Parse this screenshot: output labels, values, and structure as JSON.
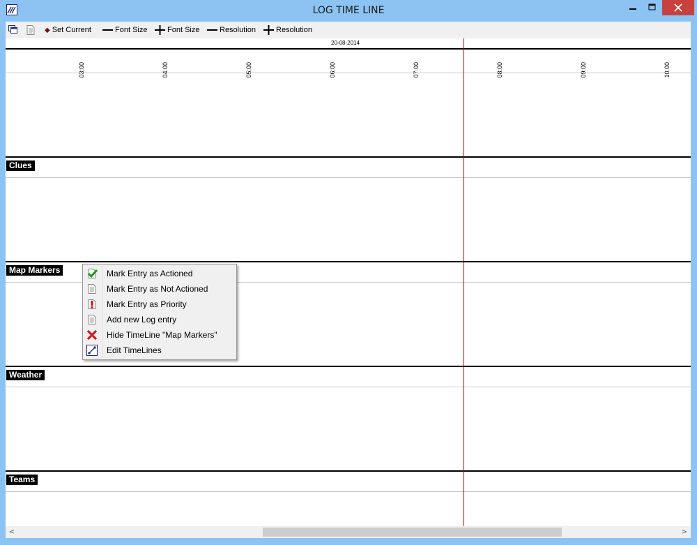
{
  "window": {
    "title": "LOG TIME LINE",
    "controls": {
      "minimize": "−",
      "maximize": "☐",
      "close": "✕"
    }
  },
  "toolbar": {
    "items": [
      {
        "label": "Set Current",
        "glyph": "•"
      },
      {
        "label": "Font Size",
        "glyph": "−"
      },
      {
        "label": "Font Size",
        "glyph": "+"
      },
      {
        "label": "Resolution",
        "glyph": "−"
      },
      {
        "label": "Resolution",
        "glyph": "+"
      }
    ]
  },
  "timeline": {
    "date": "20-08-2014",
    "hours": [
      "03:00",
      "04:00",
      "05:00",
      "06:00",
      "07:00",
      "08:00",
      "09:00",
      "10:00"
    ],
    "rows": [
      "Clues",
      "Map Markers",
      "Weather",
      "Teams"
    ],
    "now_line_color": "#c00000"
  },
  "context_menu": {
    "items": [
      {
        "label": "Mark Entry as Actioned",
        "icon": "check-document-icon"
      },
      {
        "label": "Mark Entry as Not Actioned",
        "icon": "document-icon"
      },
      {
        "label": "Mark Entry as Priority",
        "icon": "priority-document-icon"
      },
      {
        "label": "Add new Log entry",
        "icon": "new-document-icon"
      },
      {
        "label": "Hide TimeLine \"Map Markers\"",
        "icon": "red-x-icon"
      },
      {
        "label": "Edit TimeLines",
        "icon": "edit-link-icon"
      }
    ]
  },
  "colors": {
    "titlebar": "#8cc3f2",
    "close_button": "#c7413f",
    "now_line": "#c00000",
    "label_bg": "#000000"
  }
}
